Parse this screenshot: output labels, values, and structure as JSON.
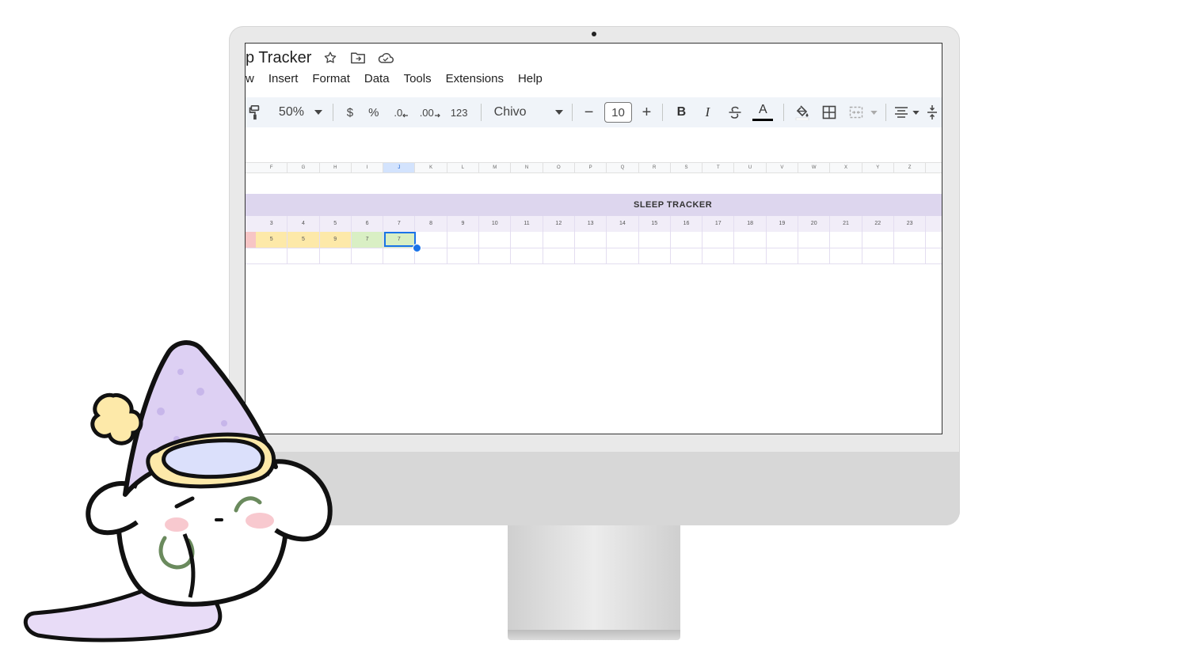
{
  "document": {
    "title": "p Tracker"
  },
  "menu": [
    "w",
    "Insert",
    "Format",
    "Data",
    "Tools",
    "Extensions",
    "Help"
  ],
  "toolbar": {
    "zoom": "50%",
    "currency": "$",
    "percent": "%",
    "decrease_decimal": ".0",
    "increase_decimal": ".00",
    "number_format": "123",
    "font": "Chivo",
    "minus": "−",
    "font_size": "10",
    "plus": "+",
    "bold": "B",
    "italic": "I",
    "text_color_letter": "A"
  },
  "columns": [
    "F",
    "G",
    "H",
    "I",
    "J",
    "K",
    "L",
    "M",
    "N",
    "O",
    "P",
    "Q",
    "R",
    "S",
    "T",
    "U",
    "V",
    "W",
    "X",
    "Y",
    "Z"
  ],
  "selected_column": "J",
  "sheet": {
    "banner_title": "SLEEP TRACKER",
    "days": [
      "3",
      "4",
      "5",
      "6",
      "7",
      "8",
      "9",
      "10",
      "11",
      "12",
      "13",
      "14",
      "15",
      "16",
      "17",
      "18",
      "19",
      "20",
      "21",
      "22",
      "23"
    ],
    "values": [
      "5",
      "5",
      "9",
      "7",
      "7",
      "",
      "",
      "",
      "",
      "",
      "",
      "",
      "",
      "",
      "",
      "",
      "",
      "",
      "",
      "",
      ""
    ],
    "value_colors": [
      "#fde9a9",
      "#fde9a9",
      "#fde9a9",
      "#d9efc4",
      "#d9efc4"
    ]
  },
  "colors": {
    "accent": "#1a73e8",
    "banner": "#ddd6ee",
    "first_cell_partial": "#f7c5c5"
  }
}
